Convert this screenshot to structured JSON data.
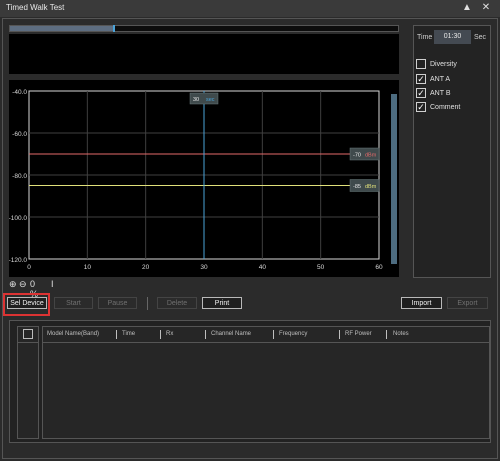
{
  "window": {
    "title": "Timed Walk Test"
  },
  "titlebar": {
    "collapse_glyph": "▲",
    "close_glyph": "✕"
  },
  "progress": {
    "fraction": 0.27,
    "marker_fraction": 0.265
  },
  "right_panel": {
    "time_label": "Time",
    "time_value": "01:30",
    "time_unit": "Sec",
    "options": [
      {
        "label": "Diversity",
        "checked": false
      },
      {
        "label": "ANT A",
        "checked": true
      },
      {
        "label": "ANT B",
        "checked": true
      },
      {
        "label": "Comment",
        "checked": true
      }
    ]
  },
  "zoom": {
    "in_icon": "⊕",
    "out_icon": "⊖",
    "value": "0 %",
    "cursor_icon": "I"
  },
  "toolbar": {
    "sel_device": "Sel Device",
    "start": "Start",
    "pause": "Pause",
    "delete": "Delete",
    "print": "Print",
    "import": "Import",
    "export": "Export"
  },
  "table": {
    "columns": [
      "Model Name(Band)",
      "Time",
      "Rx",
      "Channel Name",
      "Frequency",
      "RF Power",
      "Notes"
    ]
  },
  "chart_data": {
    "type": "line",
    "title": "",
    "xlabel": "",
    "ylabel": "",
    "xlim": [
      0,
      60
    ],
    "ylim": [
      -120,
      -40
    ],
    "x_ticks": [
      "0",
      "10",
      "20",
      "30",
      "40",
      "50",
      "60"
    ],
    "y_ticks": [
      "-40.0",
      "-60.0",
      "-80.0",
      "-100.0",
      "-120.0"
    ],
    "grid": true,
    "cursor": {
      "x": 30,
      "label": "30",
      "unit": "sec"
    },
    "series": [
      {
        "value": -70,
        "label": "-70",
        "unit": "dBm",
        "color": "#e46a6a"
      },
      {
        "value": -85,
        "label": "-85",
        "unit": "dBm",
        "color": "#e0e07a"
      }
    ],
    "colors": {
      "grid": "#3f3f3f",
      "axis": "#d8d8d8",
      "cursor": "#4aa3d8"
    }
  }
}
